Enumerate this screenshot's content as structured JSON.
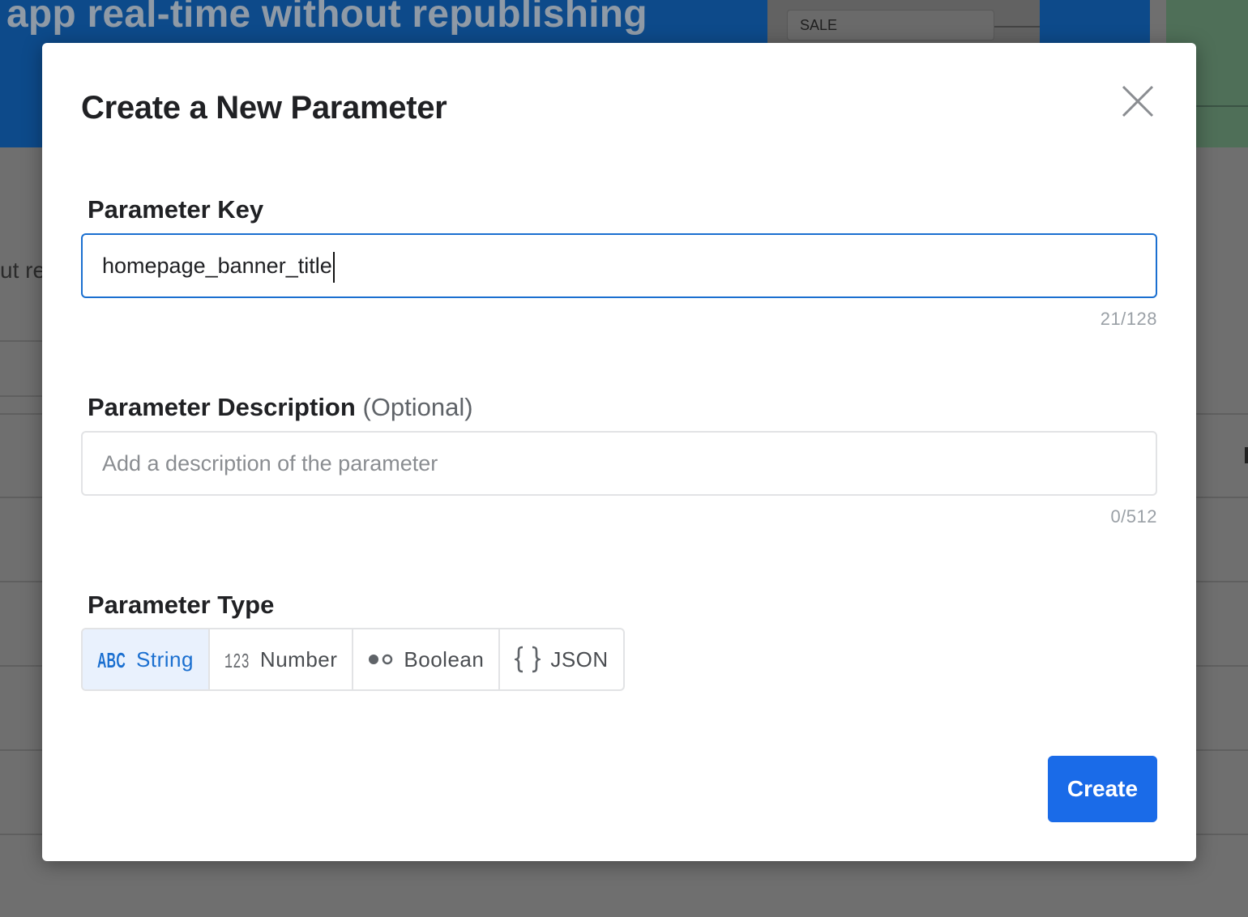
{
  "background": {
    "hero_title": "app real-time without republishing",
    "sale_label": "SALE",
    "partial_text": "ut re"
  },
  "modal": {
    "title": "Create a New Parameter",
    "key_field": {
      "label": "Parameter Key",
      "value": "homepage_banner_title",
      "counter": "21/128"
    },
    "description_field": {
      "label": "Parameter Description",
      "optional_label": "(Optional)",
      "placeholder": "Add a description of the parameter",
      "value": "",
      "counter": "0/512"
    },
    "type_field": {
      "label": "Parameter Type",
      "selected": "String",
      "options": [
        {
          "label": "String",
          "icon": "abc-icon"
        },
        {
          "label": "Number",
          "icon": "123-icon"
        },
        {
          "label": "Boolean",
          "icon": "toggle-icon"
        },
        {
          "label": "JSON",
          "icon": "curly-braces-icon"
        }
      ]
    },
    "create_label": "Create"
  },
  "colors": {
    "accent": "#1a6fd0",
    "button": "#1a6be8",
    "selected_bg": "#e9f1fd"
  }
}
